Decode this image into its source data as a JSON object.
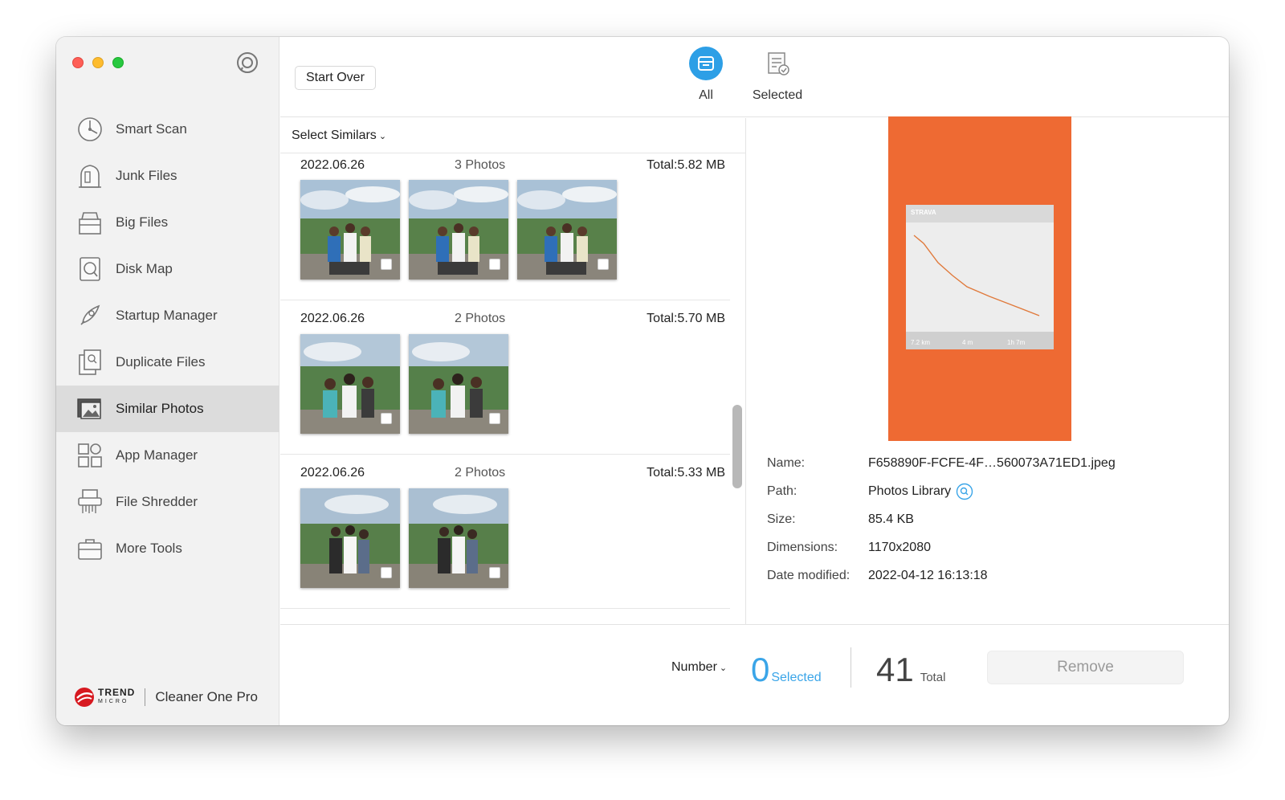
{
  "app": {
    "brand_name": "TREND",
    "brand_sub": "MICRO",
    "product_name": "Cleaner One Pro"
  },
  "sidebar": {
    "items": [
      {
        "label": "Smart Scan",
        "icon": "smart-scan-icon"
      },
      {
        "label": "Junk Files",
        "icon": "junk-files-icon"
      },
      {
        "label": "Big Files",
        "icon": "big-files-icon"
      },
      {
        "label": "Disk Map",
        "icon": "disk-map-icon"
      },
      {
        "label": "Startup Manager",
        "icon": "startup-manager-icon"
      },
      {
        "label": "Duplicate Files",
        "icon": "duplicate-files-icon"
      },
      {
        "label": "Similar Photos",
        "icon": "similar-photos-icon",
        "active": true
      },
      {
        "label": "App Manager",
        "icon": "app-manager-icon"
      },
      {
        "label": "File Shredder",
        "icon": "file-shredder-icon"
      },
      {
        "label": "More Tools",
        "icon": "more-tools-icon"
      }
    ]
  },
  "toolbar": {
    "start_over_label": "Start Over",
    "tab_all_label": "All",
    "tab_selected_label": "Selected"
  },
  "list": {
    "select_similars_label": "Select Similars",
    "groups": [
      {
        "date": "2022.06.26",
        "count": "3 Photos",
        "total": "Total:5.82 MB",
        "thumbs": 3
      },
      {
        "date": "2022.06.26",
        "count": "2 Photos",
        "total": "Total:5.70 MB",
        "thumbs": 2
      },
      {
        "date": "2022.06.26",
        "count": "2 Photos",
        "total": "Total:5.33 MB",
        "thumbs": 2
      }
    ]
  },
  "preview": {
    "strava_label": "STRAVA",
    "stats": [
      "7.2 km",
      "4 m",
      "1h 7m"
    ]
  },
  "details": {
    "name_label": "Name:",
    "name_value": "F658890F-FCFE-4F…560073A71ED1.jpeg",
    "path_label": "Path:",
    "path_value": "Photos Library",
    "size_label": "Size:",
    "size_value": "85.4 KB",
    "dimensions_label": "Dimensions:",
    "dimensions_value": "1170x2080",
    "date_label": "Date modified:",
    "date_value": "2022-04-12 16:13:18"
  },
  "footer": {
    "sort_label": "Number",
    "selected_count": "0",
    "selected_label": "Selected",
    "total_count": "41",
    "total_label": "Total",
    "remove_label": "Remove"
  },
  "colors": {
    "accent": "#2d9fe6",
    "preview_bg": "#ee6a33",
    "traffic_red": "#fe5f57",
    "traffic_yellow": "#febc2e",
    "traffic_green": "#28c840"
  }
}
